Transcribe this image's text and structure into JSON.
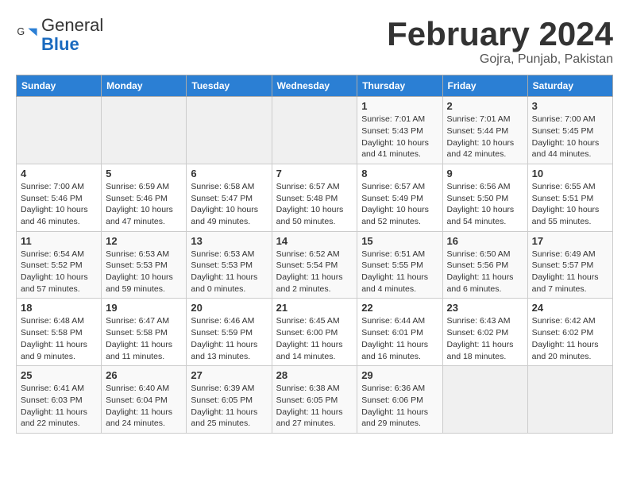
{
  "logo": {
    "general": "General",
    "blue": "Blue"
  },
  "header": {
    "month": "February 2024",
    "location": "Gojra, Punjab, Pakistan"
  },
  "weekdays": [
    "Sunday",
    "Monday",
    "Tuesday",
    "Wednesday",
    "Thursday",
    "Friday",
    "Saturday"
  ],
  "weeks": [
    [
      {
        "day": "",
        "info": ""
      },
      {
        "day": "",
        "info": ""
      },
      {
        "day": "",
        "info": ""
      },
      {
        "day": "",
        "info": ""
      },
      {
        "day": "1",
        "info": "Sunrise: 7:01 AM\nSunset: 5:43 PM\nDaylight: 10 hours and 41 minutes."
      },
      {
        "day": "2",
        "info": "Sunrise: 7:01 AM\nSunset: 5:44 PM\nDaylight: 10 hours and 42 minutes."
      },
      {
        "day": "3",
        "info": "Sunrise: 7:00 AM\nSunset: 5:45 PM\nDaylight: 10 hours and 44 minutes."
      }
    ],
    [
      {
        "day": "4",
        "info": "Sunrise: 7:00 AM\nSunset: 5:46 PM\nDaylight: 10 hours and 46 minutes."
      },
      {
        "day": "5",
        "info": "Sunrise: 6:59 AM\nSunset: 5:46 PM\nDaylight: 10 hours and 47 minutes."
      },
      {
        "day": "6",
        "info": "Sunrise: 6:58 AM\nSunset: 5:47 PM\nDaylight: 10 hours and 49 minutes."
      },
      {
        "day": "7",
        "info": "Sunrise: 6:57 AM\nSunset: 5:48 PM\nDaylight: 10 hours and 50 minutes."
      },
      {
        "day": "8",
        "info": "Sunrise: 6:57 AM\nSunset: 5:49 PM\nDaylight: 10 hours and 52 minutes."
      },
      {
        "day": "9",
        "info": "Sunrise: 6:56 AM\nSunset: 5:50 PM\nDaylight: 10 hours and 54 minutes."
      },
      {
        "day": "10",
        "info": "Sunrise: 6:55 AM\nSunset: 5:51 PM\nDaylight: 10 hours and 55 minutes."
      }
    ],
    [
      {
        "day": "11",
        "info": "Sunrise: 6:54 AM\nSunset: 5:52 PM\nDaylight: 10 hours and 57 minutes."
      },
      {
        "day": "12",
        "info": "Sunrise: 6:53 AM\nSunset: 5:53 PM\nDaylight: 10 hours and 59 minutes."
      },
      {
        "day": "13",
        "info": "Sunrise: 6:53 AM\nSunset: 5:53 PM\nDaylight: 11 hours and 0 minutes."
      },
      {
        "day": "14",
        "info": "Sunrise: 6:52 AM\nSunset: 5:54 PM\nDaylight: 11 hours and 2 minutes."
      },
      {
        "day": "15",
        "info": "Sunrise: 6:51 AM\nSunset: 5:55 PM\nDaylight: 11 hours and 4 minutes."
      },
      {
        "day": "16",
        "info": "Sunrise: 6:50 AM\nSunset: 5:56 PM\nDaylight: 11 hours and 6 minutes."
      },
      {
        "day": "17",
        "info": "Sunrise: 6:49 AM\nSunset: 5:57 PM\nDaylight: 11 hours and 7 minutes."
      }
    ],
    [
      {
        "day": "18",
        "info": "Sunrise: 6:48 AM\nSunset: 5:58 PM\nDaylight: 11 hours and 9 minutes."
      },
      {
        "day": "19",
        "info": "Sunrise: 6:47 AM\nSunset: 5:58 PM\nDaylight: 11 hours and 11 minutes."
      },
      {
        "day": "20",
        "info": "Sunrise: 6:46 AM\nSunset: 5:59 PM\nDaylight: 11 hours and 13 minutes."
      },
      {
        "day": "21",
        "info": "Sunrise: 6:45 AM\nSunset: 6:00 PM\nDaylight: 11 hours and 14 minutes."
      },
      {
        "day": "22",
        "info": "Sunrise: 6:44 AM\nSunset: 6:01 PM\nDaylight: 11 hours and 16 minutes."
      },
      {
        "day": "23",
        "info": "Sunrise: 6:43 AM\nSunset: 6:02 PM\nDaylight: 11 hours and 18 minutes."
      },
      {
        "day": "24",
        "info": "Sunrise: 6:42 AM\nSunset: 6:02 PM\nDaylight: 11 hours and 20 minutes."
      }
    ],
    [
      {
        "day": "25",
        "info": "Sunrise: 6:41 AM\nSunset: 6:03 PM\nDaylight: 11 hours and 22 minutes."
      },
      {
        "day": "26",
        "info": "Sunrise: 6:40 AM\nSunset: 6:04 PM\nDaylight: 11 hours and 24 minutes."
      },
      {
        "day": "27",
        "info": "Sunrise: 6:39 AM\nSunset: 6:05 PM\nDaylight: 11 hours and 25 minutes."
      },
      {
        "day": "28",
        "info": "Sunrise: 6:38 AM\nSunset: 6:05 PM\nDaylight: 11 hours and 27 minutes."
      },
      {
        "day": "29",
        "info": "Sunrise: 6:36 AM\nSunset: 6:06 PM\nDaylight: 11 hours and 29 minutes."
      },
      {
        "day": "",
        "info": ""
      },
      {
        "day": "",
        "info": ""
      }
    ]
  ]
}
